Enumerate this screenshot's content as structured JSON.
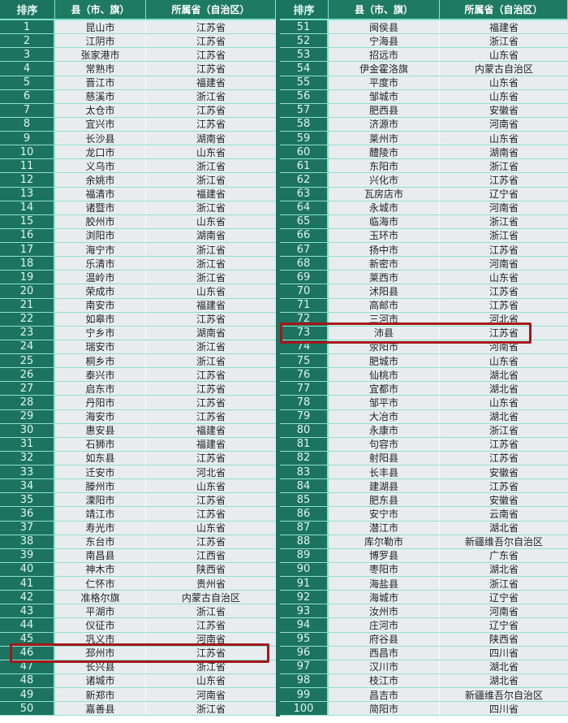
{
  "headers": {
    "rank": "排序",
    "county": "县（市、旗）",
    "province": "所属省（自治区）"
  },
  "highlight_color": "#a4161a",
  "highlighted_ranks": [
    46,
    73
  ],
  "rows": [
    [
      "1",
      "昆山市",
      "江苏省"
    ],
    [
      "2",
      "江阴市",
      "江苏省"
    ],
    [
      "3",
      "张家港市",
      "江苏省"
    ],
    [
      "4",
      "常熟市",
      "江苏省"
    ],
    [
      "5",
      "晋江市",
      "福建省"
    ],
    [
      "6",
      "慈溪市",
      "浙江省"
    ],
    [
      "7",
      "太仓市",
      "江苏省"
    ],
    [
      "8",
      "宜兴市",
      "江苏省"
    ],
    [
      "9",
      "长沙县",
      "湖南省"
    ],
    [
      "10",
      "龙口市",
      "山东省"
    ],
    [
      "11",
      "义乌市",
      "浙江省"
    ],
    [
      "12",
      "余姚市",
      "浙江省"
    ],
    [
      "13",
      "福清市",
      "福建省"
    ],
    [
      "14",
      "诸暨市",
      "浙江省"
    ],
    [
      "15",
      "胶州市",
      "山东省"
    ],
    [
      "16",
      "浏阳市",
      "湖南省"
    ],
    [
      "17",
      "海宁市",
      "浙江省"
    ],
    [
      "18",
      "乐清市",
      "浙江省"
    ],
    [
      "19",
      "温岭市",
      "浙江省"
    ],
    [
      "20",
      "荣成市",
      "山东省"
    ],
    [
      "21",
      "南安市",
      "福建省"
    ],
    [
      "22",
      "如皋市",
      "江苏省"
    ],
    [
      "23",
      "宁乡市",
      "湖南省"
    ],
    [
      "24",
      "瑞安市",
      "浙江省"
    ],
    [
      "25",
      "桐乡市",
      "浙江省"
    ],
    [
      "26",
      "泰兴市",
      "江苏省"
    ],
    [
      "27",
      "启东市",
      "江苏省"
    ],
    [
      "28",
      "丹阳市",
      "江苏省"
    ],
    [
      "29",
      "海安市",
      "江苏省"
    ],
    [
      "30",
      "惠安县",
      "福建省"
    ],
    [
      "31",
      "石狮市",
      "福建省"
    ],
    [
      "32",
      "如东县",
      "江苏省"
    ],
    [
      "33",
      "迁安市",
      "河北省"
    ],
    [
      "34",
      "滕州市",
      "山东省"
    ],
    [
      "35",
      "溧阳市",
      "江苏省"
    ],
    [
      "36",
      "靖江市",
      "江苏省"
    ],
    [
      "37",
      "寿光市",
      "山东省"
    ],
    [
      "38",
      "东台市",
      "江苏省"
    ],
    [
      "39",
      "南昌县",
      "江西省"
    ],
    [
      "40",
      "神木市",
      "陕西省"
    ],
    [
      "41",
      "仁怀市",
      "贵州省"
    ],
    [
      "42",
      "准格尔旗",
      "内蒙古自治区"
    ],
    [
      "43",
      "平湖市",
      "浙江省"
    ],
    [
      "44",
      "仪征市",
      "江苏省"
    ],
    [
      "45",
      "巩义市",
      "河南省"
    ],
    [
      "46",
      "邳州市",
      "江苏省"
    ],
    [
      "47",
      "长兴县",
      "浙江省"
    ],
    [
      "48",
      "诸城市",
      "山东省"
    ],
    [
      "49",
      "新郑市",
      "河南省"
    ],
    [
      "50",
      "嘉善县",
      "浙江省"
    ],
    [
      "51",
      "闽侯县",
      "福建省"
    ],
    [
      "52",
      "宁海县",
      "浙江省"
    ],
    [
      "53",
      "招远市",
      "山东省"
    ],
    [
      "54",
      "伊金霍洛旗",
      "内蒙古自治区"
    ],
    [
      "55",
      "平度市",
      "山东省"
    ],
    [
      "56",
      "邹城市",
      "山东省"
    ],
    [
      "57",
      "肥西县",
      "安徽省"
    ],
    [
      "58",
      "济源市",
      "河南省"
    ],
    [
      "59",
      "莱州市",
      "山东省"
    ],
    [
      "60",
      "醴陵市",
      "湖南省"
    ],
    [
      "61",
      "东阳市",
      "浙江省"
    ],
    [
      "62",
      "兴化市",
      "江苏省"
    ],
    [
      "63",
      "瓦房店市",
      "辽宁省"
    ],
    [
      "64",
      "永城市",
      "河南省"
    ],
    [
      "65",
      "临海市",
      "浙江省"
    ],
    [
      "66",
      "玉环市",
      "浙江省"
    ],
    [
      "67",
      "扬中市",
      "江苏省"
    ],
    [
      "68",
      "新密市",
      "河南省"
    ],
    [
      "69",
      "莱西市",
      "山东省"
    ],
    [
      "70",
      "沭阳县",
      "江苏省"
    ],
    [
      "71",
      "高邮市",
      "江苏省"
    ],
    [
      "72",
      "三河市",
      "河北省"
    ],
    [
      "73",
      "沛县",
      "江苏省"
    ],
    [
      "74",
      "荥阳市",
      "河南省"
    ],
    [
      "75",
      "肥城市",
      "山东省"
    ],
    [
      "76",
      "仙桃市",
      "湖北省"
    ],
    [
      "77",
      "宜都市",
      "湖北省"
    ],
    [
      "78",
      "邹平市",
      "山东省"
    ],
    [
      "79",
      "大冶市",
      "湖北省"
    ],
    [
      "80",
      "永康市",
      "浙江省"
    ],
    [
      "81",
      "句容市",
      "江苏省"
    ],
    [
      "82",
      "射阳县",
      "江苏省"
    ],
    [
      "83",
      "长丰县",
      "安徽省"
    ],
    [
      "84",
      "建湖县",
      "江苏省"
    ],
    [
      "85",
      "肥东县",
      "安徽省"
    ],
    [
      "86",
      "安宁市",
      "云南省"
    ],
    [
      "87",
      "潜江市",
      "湖北省"
    ],
    [
      "88",
      "库尔勒市",
      "新疆维吾尔自治区"
    ],
    [
      "89",
      "博罗县",
      "广东省"
    ],
    [
      "90",
      "枣阳市",
      "湖北省"
    ],
    [
      "91",
      "海盐县",
      "浙江省"
    ],
    [
      "92",
      "海城市",
      "辽宁省"
    ],
    [
      "93",
      "汝州市",
      "河南省"
    ],
    [
      "94",
      "庄河市",
      "辽宁省"
    ],
    [
      "95",
      "府谷县",
      "陕西省"
    ],
    [
      "96",
      "西昌市",
      "四川省"
    ],
    [
      "97",
      "汉川市",
      "湖北省"
    ],
    [
      "98",
      "枝江市",
      "湖北省"
    ],
    [
      "99",
      "昌吉市",
      "新疆维吾尔自治区"
    ],
    [
      "100",
      "简阳市",
      "四川省"
    ]
  ]
}
